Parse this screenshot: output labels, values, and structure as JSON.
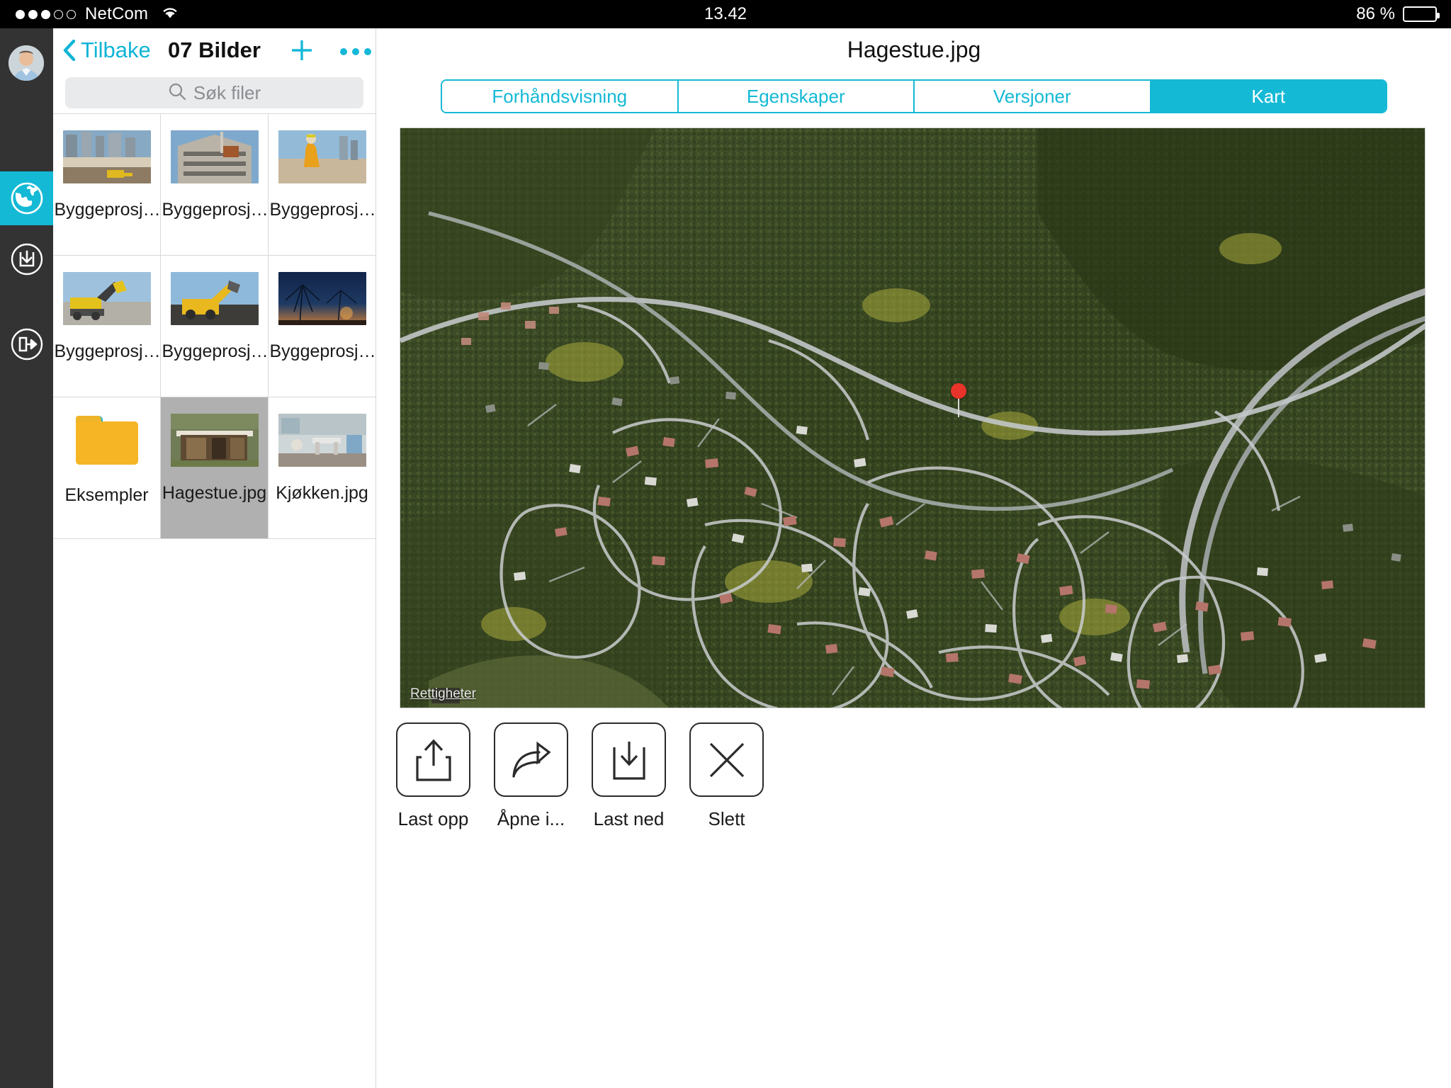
{
  "statusbar": {
    "carrier": "NetCom",
    "signal_filled": 3,
    "signal_empty": 2,
    "wifi_icon": "wifi-icon",
    "time": "13.42",
    "battery_text": "86 %",
    "battery_percent": 86
  },
  "rail": {
    "avatar_name": "user-avatar",
    "items": [
      {
        "icon": "globe-icon",
        "name": "sidebar-item-files",
        "active": true
      },
      {
        "icon": "download-box-icon",
        "name": "sidebar-item-offline",
        "active": false
      },
      {
        "icon": "logout-icon",
        "name": "sidebar-item-logout",
        "active": false
      }
    ],
    "active_color": "#14b9d5",
    "background": "#333333"
  },
  "browser": {
    "back_label": "Tilbake",
    "title": "07 Bilder",
    "add_icon": "plus-icon",
    "more_icon": "ellipsis-icon",
    "accent": "#0fb5d6",
    "search": {
      "placeholder": "Søk filer",
      "icon": "search-icon",
      "value": ""
    },
    "files": [
      {
        "label": "Byggeprosj…",
        "type": "image",
        "selected": false
      },
      {
        "label": "Byggeprosj…",
        "type": "image",
        "selected": false
      },
      {
        "label": "Byggeprosj…",
        "type": "image",
        "selected": false
      },
      {
        "label": "Byggeprosj…",
        "type": "image",
        "selected": false
      },
      {
        "label": "Byggeprosj…",
        "type": "image",
        "selected": false
      },
      {
        "label": "Byggeprosj…",
        "type": "image",
        "selected": false
      },
      {
        "label": "Eksempler",
        "type": "folder",
        "selected": false
      },
      {
        "label": "Hagestue.jpg",
        "type": "image",
        "selected": true
      },
      {
        "label": "Kjøkken.jpg",
        "type": "image",
        "selected": false
      }
    ]
  },
  "detail": {
    "title": "Hagestue.jpg",
    "tabs": [
      {
        "label": "Forhåndsvisning",
        "active": false
      },
      {
        "label": "Egenskaper",
        "active": false
      },
      {
        "label": "Versjoner",
        "active": false
      },
      {
        "label": "Kart",
        "active": true
      }
    ],
    "tab_accent": "#14b9d5",
    "map": {
      "attribution": "Rettigheter",
      "pin_icon": "map-pin-icon",
      "pin_color": "#e8342b",
      "view": "satellite"
    },
    "toolbar": [
      {
        "label": "Last opp",
        "icon": "upload-icon"
      },
      {
        "label": "Åpne i...",
        "icon": "share-arrow-icon"
      },
      {
        "label": "Last ned",
        "icon": "download-icon"
      },
      {
        "label": "Slett",
        "icon": "close-x-icon"
      }
    ]
  }
}
